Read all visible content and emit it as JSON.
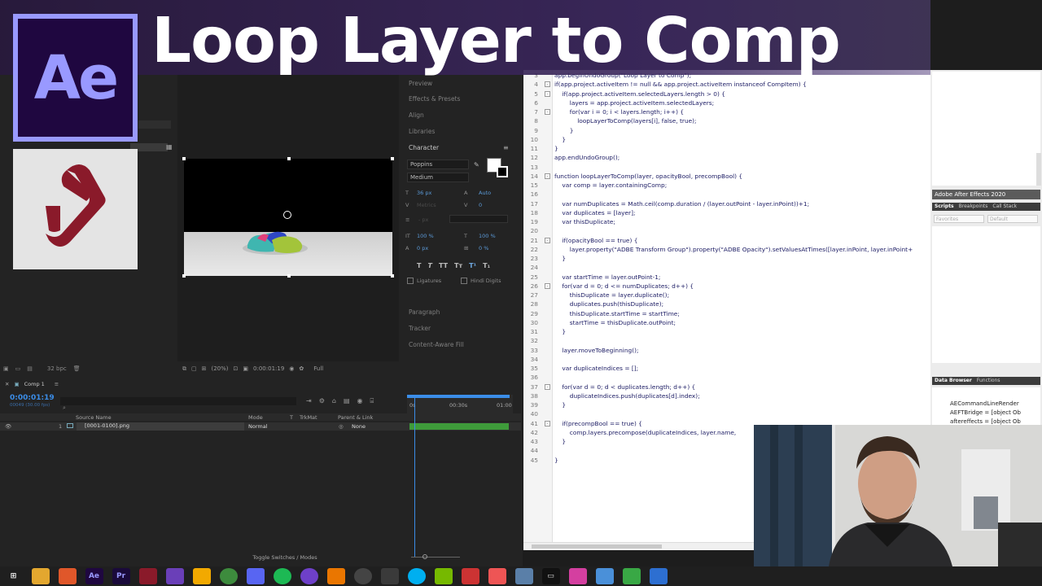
{
  "title": "Loop Layer to Comp",
  "ae_logo_text": "Ae",
  "ae": {
    "panels": {
      "preview": "Preview",
      "effects": "Effects & Presets",
      "align": "Align",
      "libraries": "Libraries",
      "character": "Character",
      "paragraph": "Paragraph",
      "tracker": "Tracker",
      "content_aware": "Content-Aware Fill"
    },
    "character": {
      "font": "Poppins",
      "style": "Medium",
      "size": "36 px",
      "leading": "Auto",
      "kerning": "Metrics",
      "tracking": "0",
      "stroke": "- px",
      "vscale": "100 %",
      "hscale": "100 %",
      "baseline": "0 px",
      "tsume": "0 %",
      "ligatures": "Ligatures",
      "hindi": "Hindi Digits"
    },
    "viewer": {
      "zoom": "(20%)",
      "time": "0:00:01:19",
      "quality": "Full",
      "bpc": "32 bpc"
    },
    "timeline": {
      "comp_tab": "Comp 1",
      "timecode": "0:00:01:19",
      "timecode_sub": "00049 (30.00 fps)",
      "cols": {
        "source": "Source Name",
        "mode": "Mode",
        "t": "T",
        "trkmat": "TrkMat",
        "parent": "Parent & Link"
      },
      "ruler": [
        "0s",
        "00:30s",
        "01:00"
      ],
      "layer": {
        "num": "1",
        "name": "[0001-0100].png",
        "mode": "Normal",
        "parent": "None"
      },
      "footer": "Toggle Switches / Modes"
    }
  },
  "editor": {
    "lines": [
      {
        "n": "3",
        "fold": "",
        "text": "app.beginUndoGroup(\"Loop Layer to Comp\");"
      },
      {
        "n": "4",
        "fold": "-",
        "text": "if(app.project.activeItem != null && app.project.activeItem instanceof CompItem) {"
      },
      {
        "n": "5",
        "fold": "-",
        "text": "    if(app.project.activeItem.selectedLayers.length > 0) {"
      },
      {
        "n": "6",
        "fold": "",
        "text": "        layers = app.project.activeItem.selectedLayers;"
      },
      {
        "n": "7",
        "fold": "-",
        "text": "        for(var i = 0; i < layers.length; i++) {"
      },
      {
        "n": "8",
        "fold": "",
        "text": "            loopLayerToComp(layers[i], false, true);"
      },
      {
        "n": "9",
        "fold": "",
        "text": "        }"
      },
      {
        "n": "10",
        "fold": "",
        "text": "    }"
      },
      {
        "n": "11",
        "fold": "",
        "text": "}"
      },
      {
        "n": "12",
        "fold": "",
        "text": "app.endUndoGroup();"
      },
      {
        "n": "13",
        "fold": "",
        "text": ""
      },
      {
        "n": "14",
        "fold": "-",
        "text": "function loopLayerToComp(layer, opacityBool, precompBool) {"
      },
      {
        "n": "15",
        "fold": "",
        "text": "    var comp = layer.containingComp;"
      },
      {
        "n": "16",
        "fold": "",
        "text": ""
      },
      {
        "n": "17",
        "fold": "",
        "text": "    var numDuplicates = Math.ceil(comp.duration / (layer.outPoint - layer.inPoint))+1;"
      },
      {
        "n": "18",
        "fold": "",
        "text": "    var duplicates = [layer];"
      },
      {
        "n": "19",
        "fold": "",
        "text": "    var thisDuplicate;"
      },
      {
        "n": "20",
        "fold": "",
        "text": ""
      },
      {
        "n": "21",
        "fold": "-",
        "text": "    if(opacityBool == true) {"
      },
      {
        "n": "22",
        "fold": "",
        "text": "        layer.property(\"ADBE Transform Group\").property(\"ADBE Opacity\").setValuesAtTimes([layer.inPoint, layer.inPoint+"
      },
      {
        "n": "23",
        "fold": "",
        "text": "    }"
      },
      {
        "n": "24",
        "fold": "",
        "text": ""
      },
      {
        "n": "25",
        "fold": "",
        "text": "    var startTime = layer.outPoint-1;"
      },
      {
        "n": "26",
        "fold": "-",
        "text": "    for(var d = 0; d <= numDuplicates; d++) {"
      },
      {
        "n": "27",
        "fold": "",
        "text": "        thisDuplicate = layer.duplicate();"
      },
      {
        "n": "28",
        "fold": "",
        "text": "        duplicates.push(thisDuplicate);"
      },
      {
        "n": "29",
        "fold": "",
        "text": "        thisDuplicate.startTime = startTime;"
      },
      {
        "n": "30",
        "fold": "",
        "text": "        startTime = thisDuplicate.outPoint;"
      },
      {
        "n": "31",
        "fold": "",
        "text": "    }"
      },
      {
        "n": "32",
        "fold": "",
        "text": ""
      },
      {
        "n": "33",
        "fold": "",
        "text": "    layer.moveToBeginning();"
      },
      {
        "n": "34",
        "fold": "",
        "text": ""
      },
      {
        "n": "35",
        "fold": "",
        "text": "    var duplicateIndices = [];"
      },
      {
        "n": "36",
        "fold": "",
        "text": ""
      },
      {
        "n": "37",
        "fold": "-",
        "text": "    for(var d = 0; d < duplicates.length; d++) {"
      },
      {
        "n": "38",
        "fold": "",
        "text": "        duplicateIndices.push(duplicates[d].index);"
      },
      {
        "n": "39",
        "fold": "",
        "text": "    }"
      },
      {
        "n": "40",
        "fold": "",
        "text": ""
      },
      {
        "n": "41",
        "fold": "-",
        "text": "    if(precompBool == true) {"
      },
      {
        "n": "42",
        "fold": "",
        "text": "        comp.layers.precompose(duplicateIndices, layer.name,"
      },
      {
        "n": "43",
        "fold": "",
        "text": "    }"
      },
      {
        "n": "44",
        "fold": "",
        "text": ""
      },
      {
        "n": "45",
        "fold": "",
        "text": "}"
      }
    ]
  },
  "estk": {
    "target": "Adobe After Effects 2020",
    "tabs": [
      "Scripts",
      "Breakpoints",
      "Call Stack"
    ],
    "favorites": "Favorites",
    "default": "Default",
    "data_tabs": [
      "Data Browser",
      "Functions"
    ],
    "data_items": [
      "AECommandLineRender",
      "AEFTBridge = [object Ob",
      "aftereffects = [object Ob"
    ]
  },
  "colors": {
    "accent_purple": "#9999ff",
    "ae_dark": "#1f0740",
    "timeline_blue": "#3b8de8",
    "scroll_logo": "#8a1a2a"
  }
}
